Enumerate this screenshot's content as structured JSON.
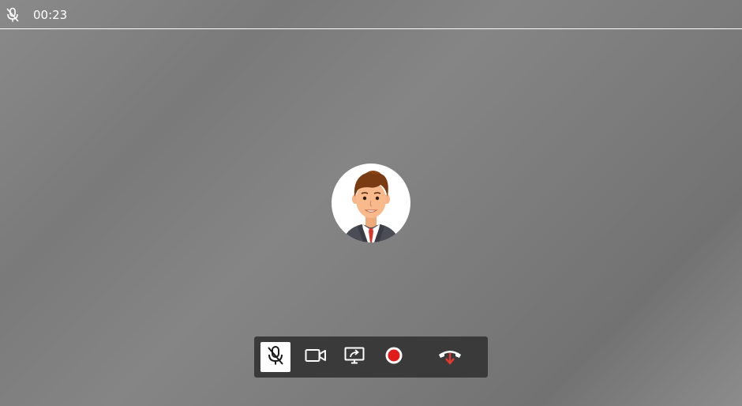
{
  "header": {
    "mic_icon": "mic-muted-icon",
    "timer": "00:23"
  },
  "avatar": {
    "icon": "user-avatar-man"
  },
  "controls": {
    "mute": {
      "icon": "mic-muted-icon",
      "active": true
    },
    "camera": {
      "icon": "video-camera-icon",
      "active": false
    },
    "screen_share": {
      "icon": "screen-share-icon",
      "active": false
    },
    "record": {
      "icon": "record-icon",
      "active": false
    },
    "hang_up": {
      "icon": "hang-up-icon",
      "active": false
    }
  },
  "colors": {
    "record": "#e11a1a",
    "hang_up": "#e8382f",
    "toolbar": "#3a3a3a",
    "active_button": "#ffffff"
  }
}
